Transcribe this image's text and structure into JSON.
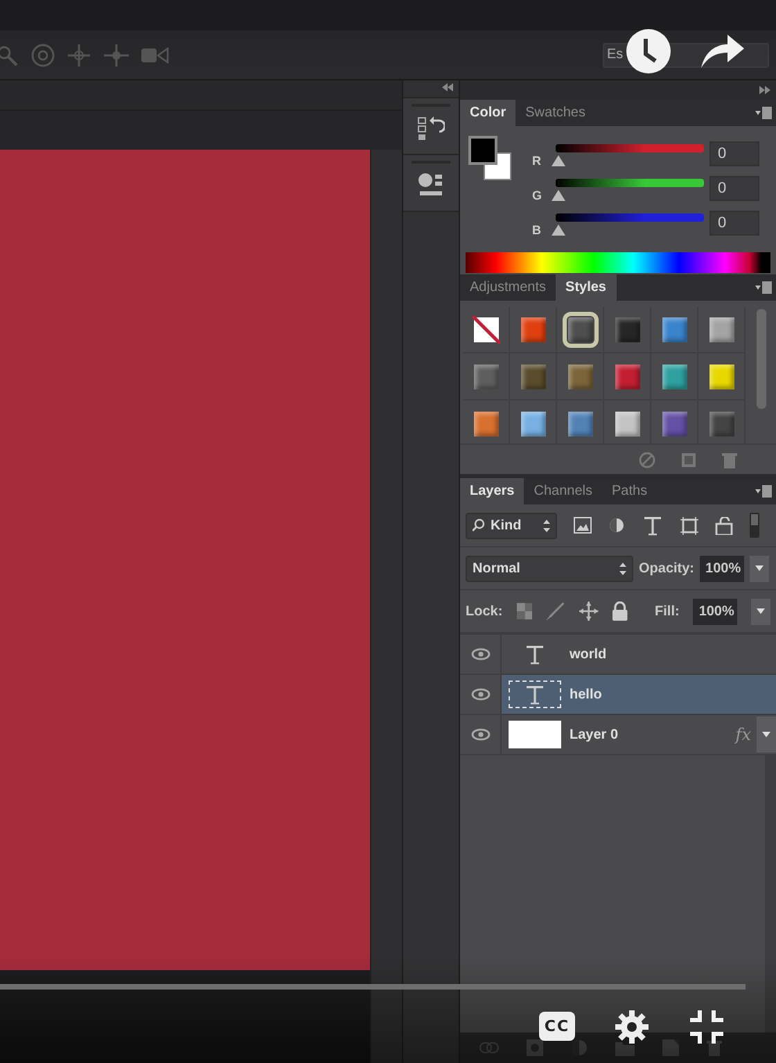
{
  "options_bar": {
    "workspace": "Es"
  },
  "color_panel": {
    "tabs": [
      {
        "label": "Color",
        "selected": true
      },
      {
        "label": "Swatches",
        "selected": false
      }
    ],
    "channels": [
      {
        "name": "R",
        "value": "0",
        "color": "#d0202e"
      },
      {
        "name": "G",
        "value": "0",
        "color": "#38c838"
      },
      {
        "name": "B",
        "value": "0",
        "color": "#2020d8"
      }
    ]
  },
  "styles_panel": {
    "tabs": [
      {
        "label": "Adjustments",
        "selected": false
      },
      {
        "label": "Styles",
        "selected": true
      }
    ],
    "styles": [
      {
        "kind": "none",
        "selected": false
      },
      {
        "kind": "swatch",
        "color": "#e04010",
        "selected": false
      },
      {
        "kind": "swatch",
        "color": "#4e4e4e",
        "selected": true
      },
      {
        "kind": "swatch",
        "color": "#262626",
        "selected": false
      },
      {
        "kind": "swatch",
        "color": "#3a84cc",
        "selected": false
      },
      {
        "kind": "swatch",
        "color": "#a4a4a4",
        "selected": false
      },
      {
        "kind": "swatch",
        "color": "#5e5e5e",
        "selected": false
      },
      {
        "kind": "swatch",
        "color": "#5a4c2c",
        "selected": false
      },
      {
        "kind": "swatch",
        "color": "#7a6438",
        "selected": false
      },
      {
        "kind": "swatch",
        "color": "#c41e32",
        "selected": false
      },
      {
        "kind": "swatch",
        "color": "#2ea0a0",
        "selected": false
      },
      {
        "kind": "swatch",
        "color": "#e8d800",
        "selected": false
      },
      {
        "kind": "swatch",
        "color": "#d87030",
        "selected": false
      },
      {
        "kind": "swatch",
        "color": "#78b0e4",
        "selected": false
      },
      {
        "kind": "swatch",
        "color": "#5282b4",
        "selected": false
      },
      {
        "kind": "swatch",
        "color": "#c4c4c4",
        "selected": false
      },
      {
        "kind": "swatch",
        "color": "#6450a4",
        "selected": false
      },
      {
        "kind": "swatch",
        "color": "#444444",
        "selected": false
      }
    ]
  },
  "layers_panel": {
    "tabs": [
      {
        "label": "Layers",
        "selected": true
      },
      {
        "label": "Channels",
        "selected": false
      },
      {
        "label": "Paths",
        "selected": false
      }
    ],
    "filter": "Kind",
    "blend_mode": "Normal",
    "opacity_label": "Opacity:",
    "opacity": "100%",
    "lock_label": "Lock:",
    "fill_label": "Fill:",
    "fill": "100%",
    "layers": [
      {
        "name": "world",
        "kind": "text",
        "visible": true,
        "selected": false
      },
      {
        "name": "hello",
        "kind": "text",
        "visible": true,
        "selected": true
      },
      {
        "name": "Layer 0",
        "kind": "image",
        "visible": true,
        "selected": false,
        "effects": "fx"
      }
    ]
  },
  "player": {
    "captions": "CC",
    "progress": {
      "level": 0.96
    }
  }
}
